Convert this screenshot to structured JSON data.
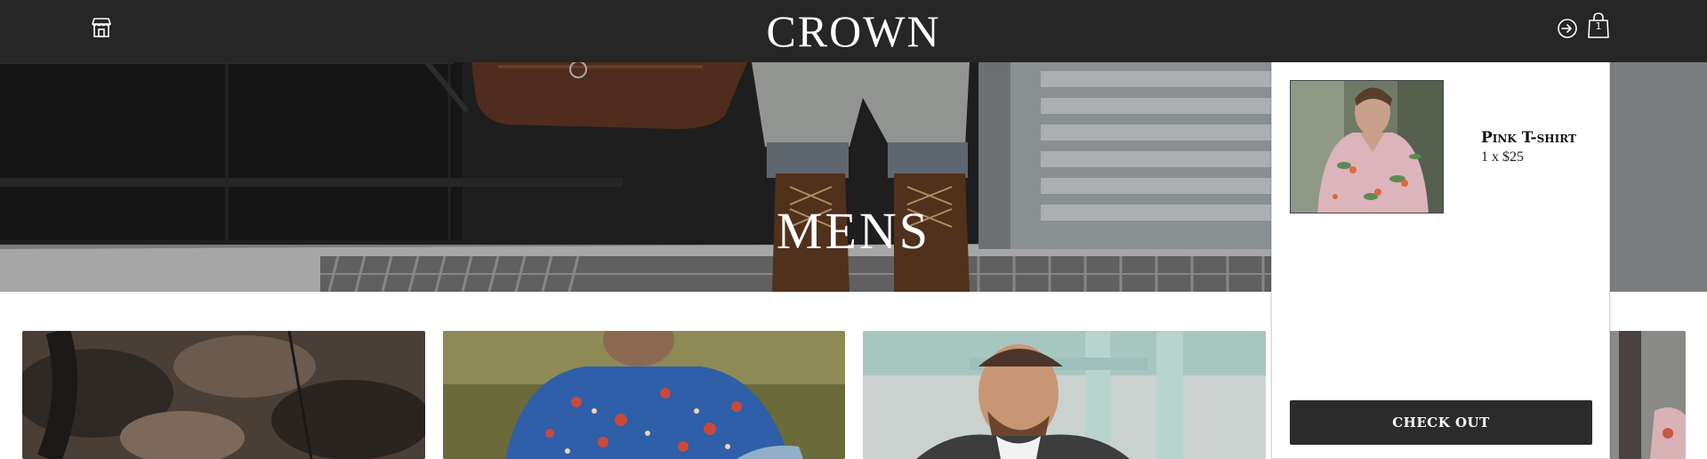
{
  "header": {
    "brand": "CROWN",
    "shop_icon": "storefront-icon",
    "signin_icon": "sign-in-icon",
    "bag_icon": "shopping-bag-icon",
    "bag_count": "1"
  },
  "hero": {
    "title": "MENS"
  },
  "tiles": [
    {
      "image": "camo-jacket-photo"
    },
    {
      "image": "floral-shirt-photo"
    },
    {
      "image": "raglan-tee-photo"
    },
    {
      "image": "floral-shirt-partial-photo"
    }
  ],
  "cart": {
    "items": [
      {
        "name": "Pink T-shirt",
        "quantity_price": "1 x $25",
        "image": "pink-tshirt-photo"
      }
    ],
    "checkout_label": "CHECK OUT"
  },
  "colors": {
    "header_bg": "#262626",
    "button_bg": "#2b2b2b",
    "text_light": "#ffffff"
  }
}
